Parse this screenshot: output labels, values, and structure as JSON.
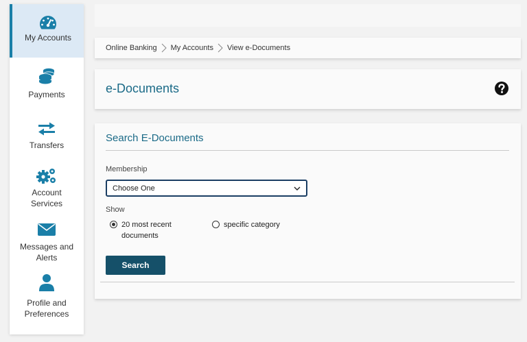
{
  "sidebar": {
    "items": [
      {
        "label": "My Accounts",
        "icon": "dashboard-icon"
      },
      {
        "label": "Payments",
        "icon": "coins-icon"
      },
      {
        "label": "Transfers",
        "icon": "transfer-arrows-icon"
      },
      {
        "label": "Account\nServices",
        "icon": "gears-icon"
      },
      {
        "label": "Messages and\nAlerts",
        "icon": "envelope-icon"
      },
      {
        "label": "Profile and\nPreferences",
        "icon": "user-icon"
      }
    ],
    "active_index": 0
  },
  "breadcrumb": {
    "items": [
      "Online Banking",
      "My Accounts",
      "View e-Documents"
    ]
  },
  "page": {
    "title": "e-Documents",
    "help_icon": "question-circle-icon"
  },
  "search": {
    "title": "Search E-Documents",
    "membership_label": "Membership",
    "membership_value": "Choose One",
    "show_label": "Show",
    "options": [
      {
        "label": "20 most recent\ndocuments",
        "checked": true
      },
      {
        "label": "specific category",
        "checked": false
      }
    ],
    "button_label": "Search"
  },
  "colors": {
    "accent": "#1a6a87",
    "icon_blue": "#1a7fa8",
    "button": "#155069",
    "active_nav": "#dce9f5"
  }
}
